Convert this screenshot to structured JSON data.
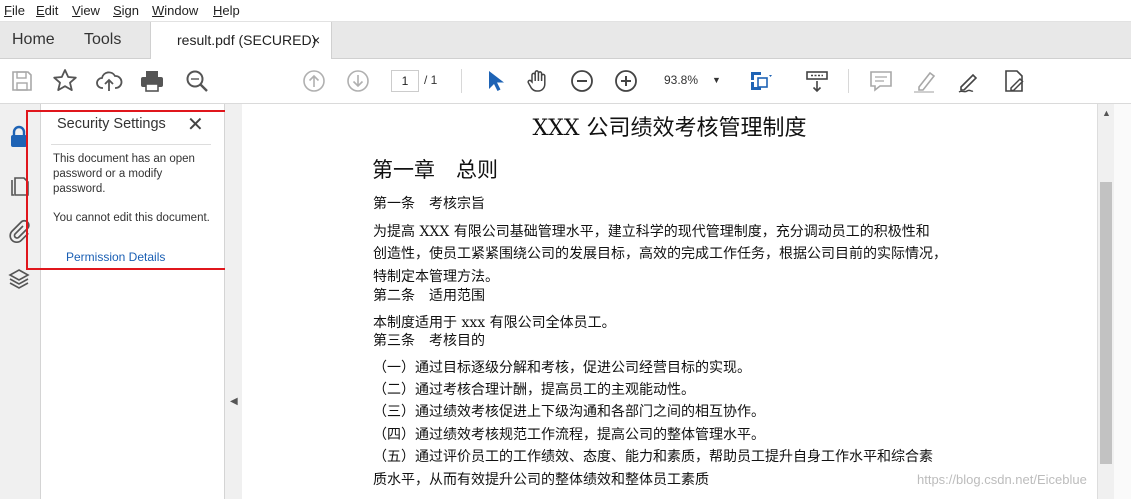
{
  "menu": {
    "file": "File",
    "edit": "Edit",
    "view": "View",
    "sign": "Sign",
    "window": "Window",
    "help": "Help"
  },
  "tabs": {
    "home": "Home",
    "tools": "Tools",
    "document": "result.pdf (SECURED)",
    "close": "×"
  },
  "toolbar": {
    "page_current": "1",
    "page_total": "/ 1",
    "zoom": "93.8%",
    "zoom_caret": "▼",
    "icons": [
      "save-icon",
      "bookmark-star-icon",
      "upload-cloud-icon",
      "print-icon",
      "zoom-search-icon",
      "page-up-icon",
      "page-down-icon",
      "select-cursor-icon",
      "hand-tool-icon",
      "zoom-out-icon",
      "zoom-in-icon",
      "fit-page-icon",
      "scroll-mode-icon",
      "comment-icon",
      "highlight-icon",
      "sign-icon",
      "fill-sign-icon"
    ],
    "accent_color": "#1e63b5"
  },
  "security_panel": {
    "title": "Security Settings",
    "close": "✕",
    "message_1": "This document has an open password or a modify password.",
    "message_2": "You cannot edit this document.",
    "link": "Permission Details",
    "highlight_color": "#e0161c"
  },
  "document": {
    "title": "XXX 公司绩效考核管理制度",
    "chapter": "第一章　总则",
    "lines": [
      "第一条　考核宗旨",
      "为提高 XXX 有限公司基础管理水平，建立科学的现代管理制度，充分调动员工的积极性和",
      "创造性，使员工紧紧围绕公司的发展目标，高效的完成工作任务，根据公司目前的实际情况，",
      "特制定本管理方法。",
      "第二条　适用范围",
      "本制度适用于 xxx 有限公司全体员工。",
      "第三条　考核目的",
      "（一）通过目标逐级分解和考核，促进公司经营目标的实现。",
      "（二）通过考核合理计酬，提高员工的主观能动性。",
      "（三）通过绩效考核促进上下级沟通和各部门之间的相互协作。",
      "（四）通过绩效考核规范工作流程，提高公司的整体管理水平。",
      "（五）通过评价员工的工作绩效、态度、能力和素质，帮助员工提升自身工作水平和综合素",
      "质水平，从而有效提升公司的整体绩效和整体员工素质"
    ]
  },
  "watermark": "https://blog.csdn.net/Eiceblue"
}
